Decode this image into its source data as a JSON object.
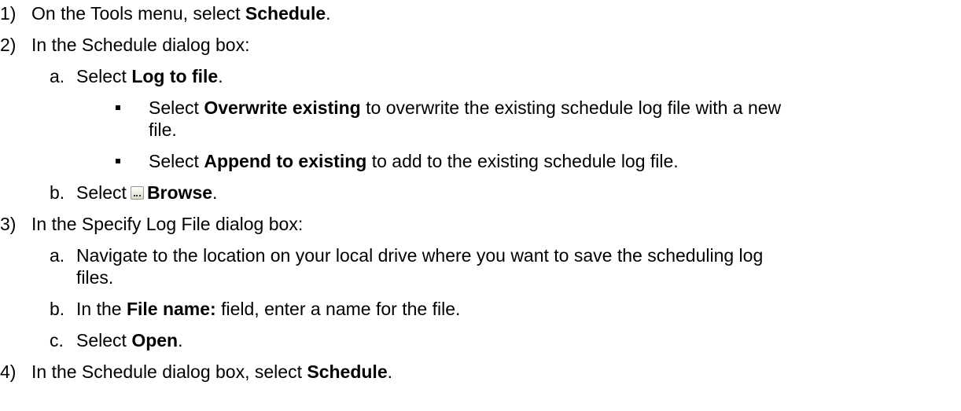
{
  "steps": [
    {
      "num": "1)",
      "pre": "On the Tools menu, select ",
      "bold": "Schedule",
      "post": "."
    },
    {
      "num": "2)",
      "text": "In the Schedule dialog box:"
    },
    {
      "num": "3)",
      "text": "In the Specify Log File dialog box:"
    },
    {
      "num": "4)",
      "pre": "In the Schedule dialog box, select ",
      "bold": "Schedule",
      "post": "."
    }
  ],
  "step2": {
    "a": {
      "letter": "a.",
      "pre": "Select ",
      "bold": "Log to file",
      "post": "."
    },
    "bullets": [
      {
        "pre": "Select ",
        "bold": "Overwrite existing",
        "post": " to overwrite the existing schedule log file with a new",
        "cont": "file."
      },
      {
        "pre": "Select ",
        "bold": "Append to existing",
        "post": " to add to the existing schedule log file."
      }
    ],
    "b": {
      "letter": "b.",
      "pre": "Select",
      "icon": "browse-ellipsis-icon",
      "bold": "Browse",
      "post": "."
    }
  },
  "step3": {
    "a": {
      "letter": "a.",
      "text": "Navigate to the location on your local drive where you want to save the scheduling log",
      "cont": "files."
    },
    "b": {
      "letter": "b.",
      "pre": "In the ",
      "bold": "File name:",
      "post": " field, enter a name for the file."
    },
    "c": {
      "letter": "c.",
      "pre": "Select ",
      "bold": "Open",
      "post": "."
    }
  }
}
